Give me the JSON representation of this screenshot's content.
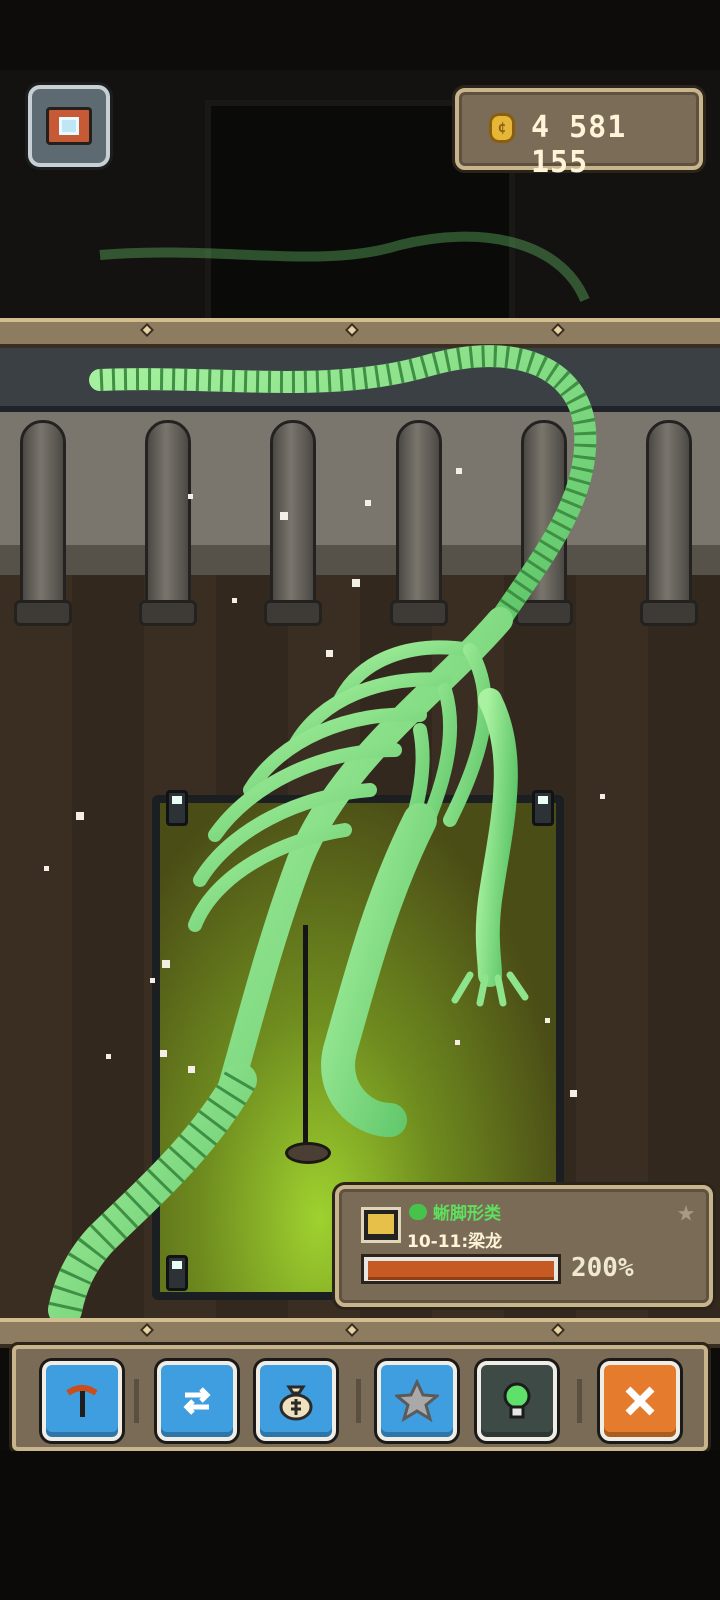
{
  "coins": {
    "value": "4 581 155"
  },
  "exhibit": {
    "class_label": "蜥脚形类",
    "name_label": "10-11:梁龙",
    "progress_percent": 200,
    "progress_text": "200%"
  },
  "toolbar": {
    "buttons": [
      {
        "icon": "pickaxe-icon"
      },
      {
        "icon": "swap-icon"
      },
      {
        "icon": "money-bag-icon"
      },
      {
        "icon": "star-icon"
      },
      {
        "icon": "lightbulb-icon"
      },
      {
        "icon": "close-icon"
      }
    ]
  },
  "colors": {
    "skeleton": "#7fe07f",
    "progress_fill": "#c55b23",
    "class_text": "#5ee05e",
    "close_button": "#e57b2c",
    "action_button": "#3f9ee0"
  }
}
